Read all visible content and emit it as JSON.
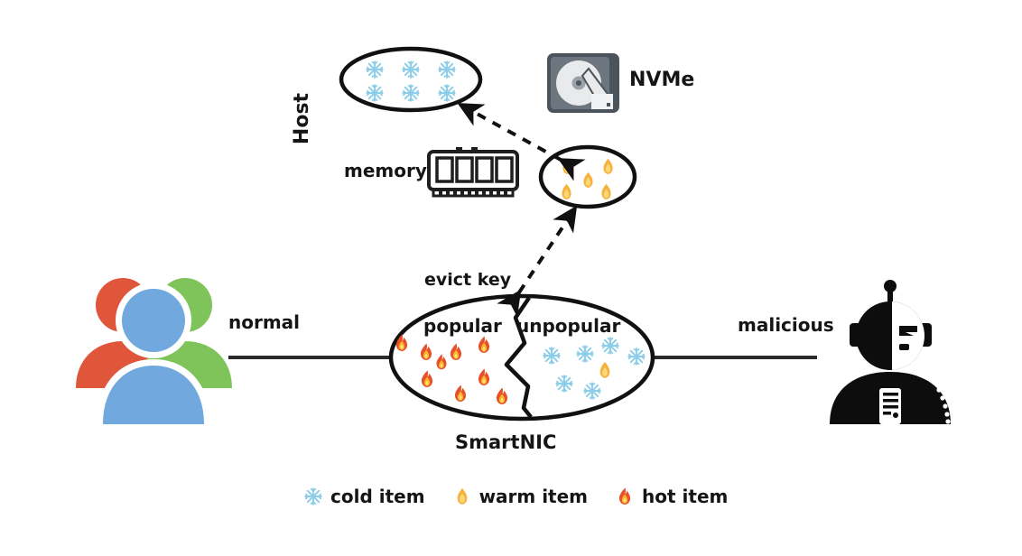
{
  "diagram": {
    "title_visible": false,
    "host": {
      "label": "Host",
      "memory_label": "memory",
      "nvme_label": "NVMe",
      "cold_ellipse": {
        "name": "cold-items-ellipse",
        "item_type": "cold",
        "item_count": 6
      },
      "warm_ellipse": {
        "name": "warm-items-ellipse",
        "item_type": "warm",
        "item_count": 5
      }
    },
    "smartnic": {
      "label": "SmartNIC",
      "popular_label": "popular",
      "unpopular_label": "unpopular",
      "popular_hot_count": 9,
      "unpopular_cold_count": 6,
      "unpopular_warm_count": 1
    },
    "edges": {
      "evict_key_label": "evict key",
      "normal_label": "normal",
      "malicious_label": "malicious"
    },
    "actors": {
      "left": "users-group-icon",
      "right": "malicious-robot-icon"
    },
    "legend": [
      {
        "icon": "snowflake-icon",
        "label": "cold item",
        "color": "#8ccdea"
      },
      {
        "icon": "warm-flame-icon",
        "label": "warm item",
        "color": "#f5b041"
      },
      {
        "icon": "hot-flame-icon",
        "label": "hot item",
        "color": "#e8502a"
      }
    ],
    "colors": {
      "host_fill": "#b9c5cf",
      "host_border": "#9aa7b1",
      "smartnic_fill": "#dfc8c5",
      "smartnic_border": "#c0675c",
      "cold": "#8ccdea",
      "warm": "#f5b041",
      "hot": "#e8502a",
      "line": "#1a1a1a",
      "user_red": "#e0563a",
      "user_green": "#7ec45a",
      "user_blue": "#71a8dd",
      "robot": "#0d0d0d"
    }
  }
}
